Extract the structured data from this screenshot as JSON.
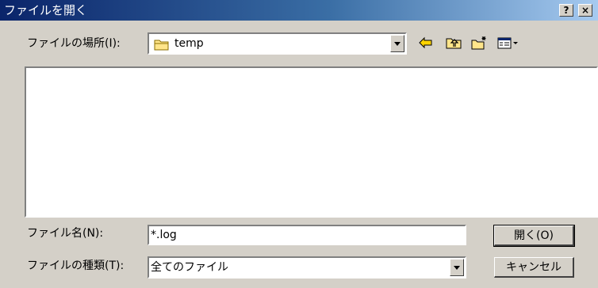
{
  "window": {
    "title": "ファイルを開く",
    "help_button": "?",
    "close_button": "×"
  },
  "location": {
    "label": "ファイルの場所(I):",
    "value": "temp",
    "icon": "folder-icon"
  },
  "toolbar": {
    "items": [
      "back-icon",
      "up-folder-icon",
      "new-folder-icon",
      "view-menu-icon"
    ]
  },
  "filename": {
    "label": "ファイル名(N):",
    "value": "*.log"
  },
  "filetype": {
    "label": "ファイルの種類(T):",
    "value": "全てのファイル"
  },
  "buttons": {
    "open": "開く(O)",
    "cancel": "キャンセル"
  },
  "colors": {
    "title_start": "#0a246a",
    "title_end": "#a6caf0",
    "face": "#d4d0c8"
  }
}
